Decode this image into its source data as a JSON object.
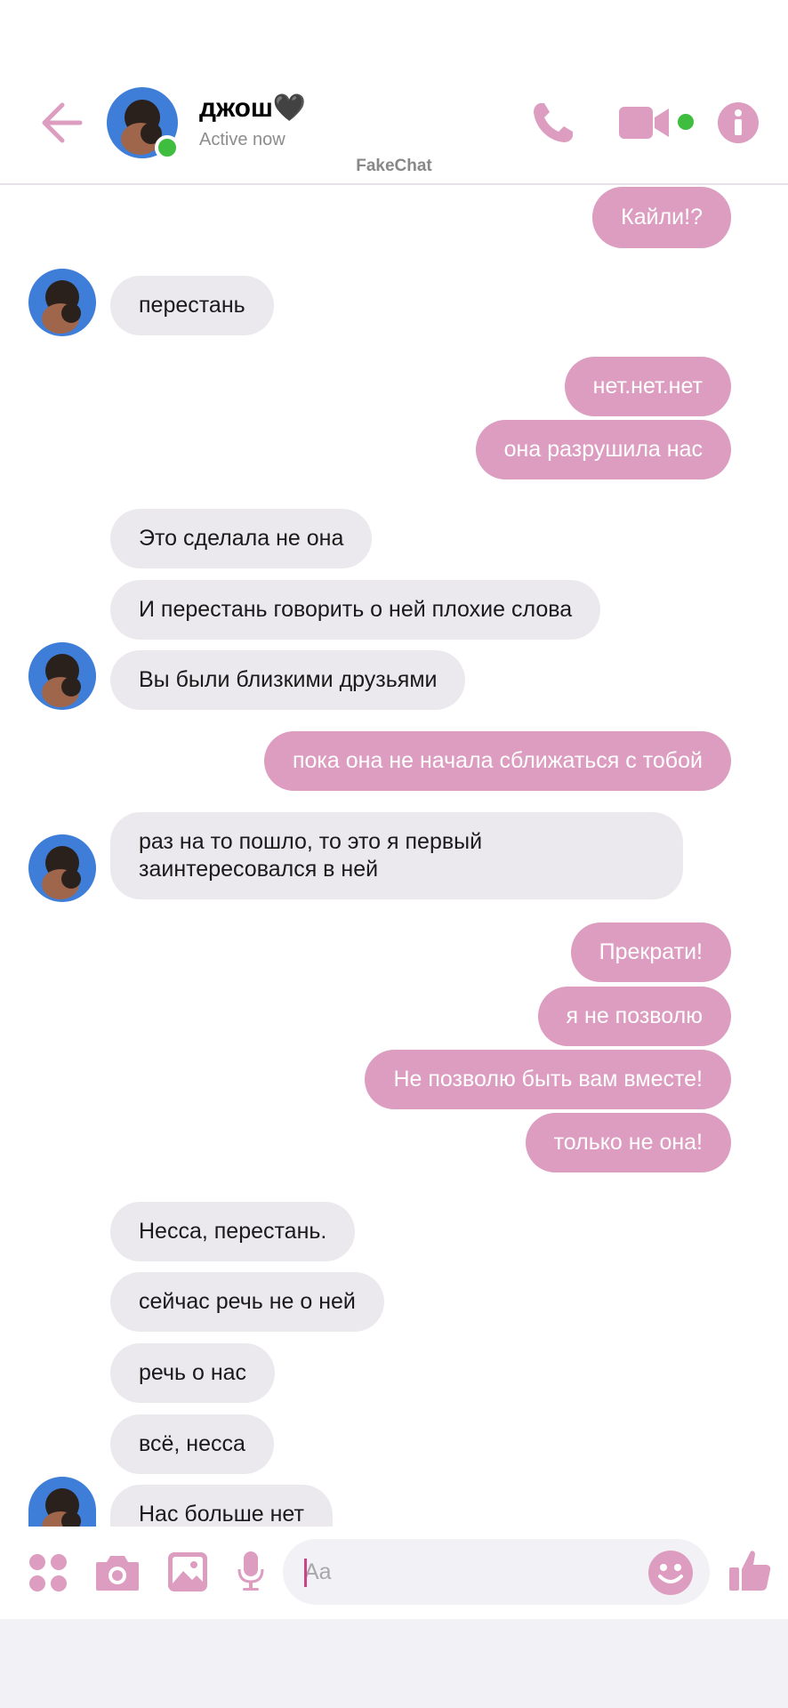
{
  "header": {
    "contact_name": "джош🖤",
    "status": "Active now",
    "app_label": "FakeChat"
  },
  "colors": {
    "accent": "#dc9dc0",
    "incoming_bubble": "#ebe9ee",
    "online": "#3fbd3f"
  },
  "icons": [
    "back-arrow",
    "phone",
    "video-camera",
    "info",
    "apps-grid",
    "camera",
    "image",
    "microphone",
    "emoji",
    "thumbs-up"
  ],
  "messages": [
    {
      "dir": "out",
      "text": "Кайли!?"
    },
    {
      "dir": "in",
      "text": "перестань"
    },
    {
      "dir": "out",
      "text": "нет.нет.нет"
    },
    {
      "dir": "out",
      "text": "она разрушила нас"
    },
    {
      "dir": "in",
      "text": "Это сделала не она"
    },
    {
      "dir": "in",
      "text": "И перестань говорить о ней плохие слова"
    },
    {
      "dir": "in",
      "text": "Вы были близкими друзьями"
    },
    {
      "dir": "out",
      "text": "пока она не начала сближаться с тобой"
    },
    {
      "dir": "in",
      "text": "раз на то пошло, то это я первый заинтересовался в ней"
    },
    {
      "dir": "out",
      "text": "Прекрати!"
    },
    {
      "dir": "out",
      "text": "я не позволю"
    },
    {
      "dir": "out",
      "text": "Не позволю быть вам вместе!"
    },
    {
      "dir": "out",
      "text": "только не она!"
    },
    {
      "dir": "in",
      "text": "Несса, перестань."
    },
    {
      "dir": "in",
      "text": "сейчас речь не о ней"
    },
    {
      "dir": "in",
      "text": "речь о нас"
    },
    {
      "dir": "in",
      "text": "всё, несса"
    },
    {
      "dir": "in",
      "text": "Нас больше нет"
    }
  ],
  "composer": {
    "placeholder": "Aa"
  }
}
